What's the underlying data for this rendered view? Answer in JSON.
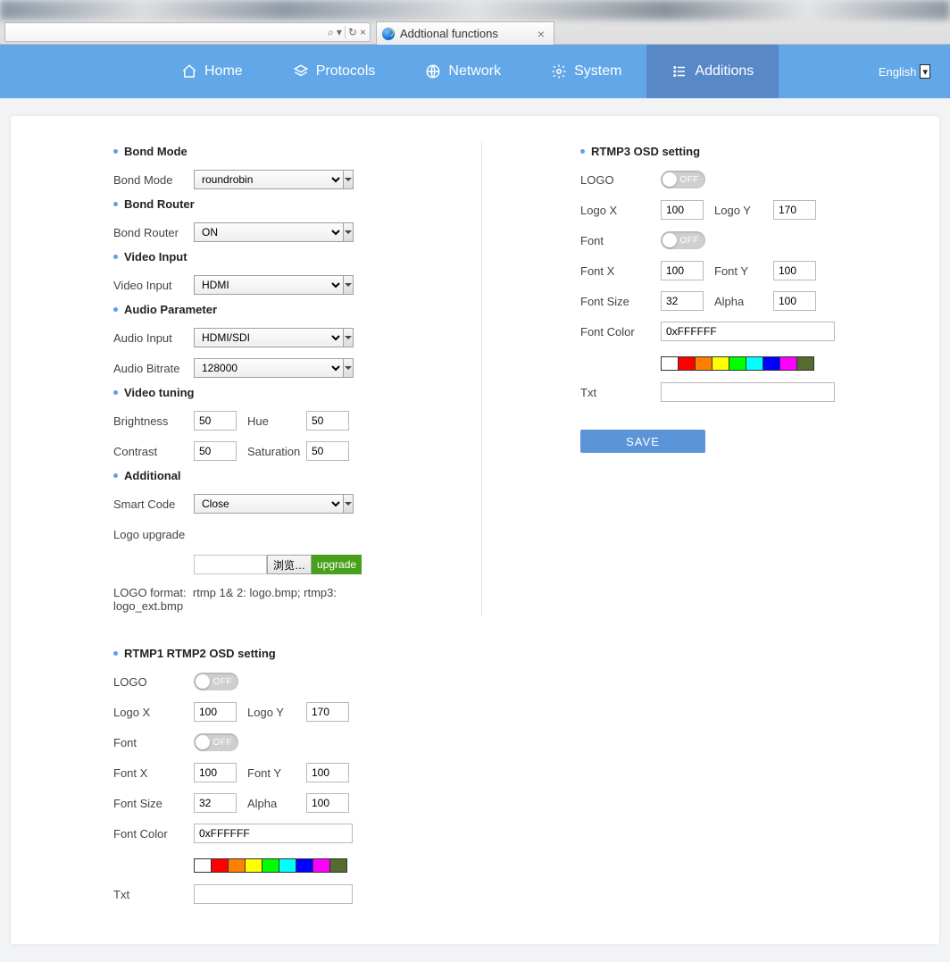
{
  "chrome": {
    "tab_title": "Addtional functions",
    "search_glyph": "⌕",
    "refresh_glyph": "↻",
    "close_glyph": "×",
    "dropdown_glyph": "▾"
  },
  "nav": {
    "home": "Home",
    "protocols": "Protocols",
    "network": "Network",
    "system": "System",
    "additions": "Additions",
    "language": "English",
    "lang_arrow": "▾"
  },
  "sections": {
    "bond_mode": "Bond Mode",
    "bond_router": "Bond Router",
    "video_input": "Video Input",
    "audio_param": "Audio Parameter",
    "video_tuning": "Video tuning",
    "additional": "Additional",
    "rtmp12": "RTMP1 RTMP2 OSD setting",
    "rtmp3": "RTMP3 OSD setting"
  },
  "labels": {
    "bond_mode": "Bond Mode",
    "bond_router": "Bond Router",
    "video_input": "Video Input",
    "audio_input": "Audio Input",
    "audio_bitrate": "Audio Bitrate",
    "brightness": "Brightness",
    "hue": "Hue",
    "contrast": "Contrast",
    "saturation": "Saturation",
    "smart_code": "Smart Code",
    "logo_upgrade": "Logo upgrade",
    "browse": "浏览…",
    "upgrade": "upgrade",
    "logo": "LOGO",
    "logox": "Logo X",
    "logoy": "Logo Y",
    "font": "Font",
    "fontx": "Font X",
    "fonty": "Font Y",
    "fontsize": "Font Size",
    "alpha": "Alpha",
    "fontcolor": "Font Color",
    "txt": "Txt",
    "off": "OFF",
    "save": "SAVE"
  },
  "values": {
    "bond_mode": "roundrobin",
    "bond_router": "ON",
    "video_input": "HDMI",
    "audio_input": "HDMI/SDI",
    "audio_bitrate": "128000",
    "brightness": "50",
    "hue": "50",
    "contrast": "50",
    "saturation": "50",
    "smart_code": "Close"
  },
  "osd1": {
    "logox": "100",
    "logoy": "170",
    "fontx": "100",
    "fonty": "100",
    "fontsize": "32",
    "alpha": "100",
    "fontcolor": "0xFFFFFF",
    "txt": ""
  },
  "osd3": {
    "logox": "100",
    "logoy": "170",
    "fontx": "100",
    "fonty": "100",
    "fontsize": "32",
    "alpha": "100",
    "fontcolor": "0xFFFFFF",
    "txt": ""
  },
  "note_prefix": "LOGO format:",
  "note_body": "rtmp 1& 2: logo.bmp; rtmp3: logo_ext.bmp",
  "swatches": [
    "#ffffff",
    "#ff0000",
    "#ff7f00",
    "#ffff00",
    "#00ff00",
    "#00ffff",
    "#0000ff",
    "#ff00ff",
    "#556b2f"
  ]
}
